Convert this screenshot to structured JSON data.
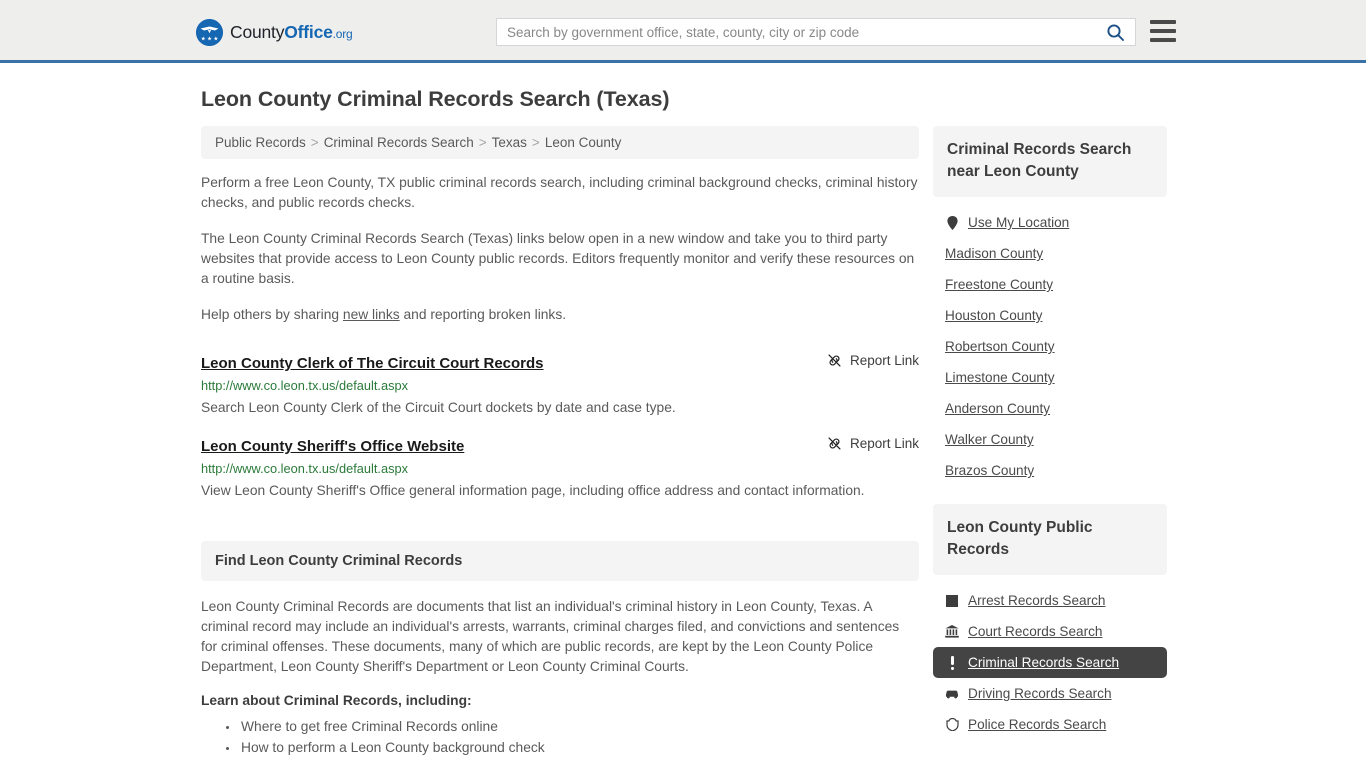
{
  "header": {
    "logo": {
      "part1": "County",
      "part2": "Office",
      "part3": ".org",
      "icon": "eagle-shield-icon"
    },
    "search": {
      "placeholder": "Search by government office, state, county, city or zip code",
      "value": "",
      "button_icon": "search-icon"
    },
    "menu_icon": "hamburger-menu-icon"
  },
  "page": {
    "title": "Leon County Criminal Records Search (Texas)"
  },
  "breadcrumb": {
    "items": [
      {
        "label": "Public Records"
      },
      {
        "label": "Criminal Records Search"
      },
      {
        "label": "Texas"
      },
      {
        "label": "Leon County"
      }
    ],
    "separator": ">"
  },
  "intro": {
    "paragraph1": "Perform a free Leon County, TX public criminal records search, including criminal background checks, criminal history checks, and public records checks.",
    "paragraph2": "The Leon County Criminal Records Search (Texas) links below open in a new window and take you to third party websites that provide access to Leon County public records. Editors frequently monitor and verify these resources on a routine basis.",
    "paragraph3_pre": "Help others by sharing ",
    "paragraph3_link": "new links",
    "paragraph3_post": " and reporting broken links."
  },
  "results": [
    {
      "title": "Leon County Clerk of The Circuit Court Records",
      "url": "http://www.co.leon.tx.us/default.aspx",
      "description": "Search Leon County Clerk of the Circuit Court dockets by date and case type.",
      "report_label": "Report Link",
      "report_icon": "broken-link-icon"
    },
    {
      "title": "Leon County Sheriff's Office Website",
      "url": "http://www.co.leon.tx.us/default.aspx",
      "description": "View Leon County Sheriff's Office general information page, including office address and contact information.",
      "report_label": "Report Link",
      "report_icon": "broken-link-icon"
    }
  ],
  "find_section": {
    "heading": "Find Leon County Criminal Records",
    "paragraph": "Leon County Criminal Records are documents that list an individual's criminal history in Leon County, Texas. A criminal record may include an individual's arrests, warrants, criminal charges filed, and convictions and sentences for criminal offenses. These documents, many of which are public records, are kept by the Leon County Police Department, Leon County Sheriff's Department or Leon County Criminal Courts.",
    "learn_heading": "Learn about Criminal Records, including:",
    "learn_items": [
      "Where to get free Criminal Records online",
      "How to perform a Leon County background check"
    ]
  },
  "sidebar": {
    "nearby_panel": {
      "heading": "Criminal Records Search near Leon County",
      "items": [
        {
          "label": "Use My Location",
          "icon": "map-pin-icon"
        },
        {
          "label": "Madison County",
          "icon": ""
        },
        {
          "label": "Freestone County",
          "icon": ""
        },
        {
          "label": "Houston County",
          "icon": ""
        },
        {
          "label": "Robertson County",
          "icon": ""
        },
        {
          "label": "Limestone County",
          "icon": ""
        },
        {
          "label": "Anderson County",
          "icon": ""
        },
        {
          "label": "Walker County",
          "icon": ""
        },
        {
          "label": "Brazos County",
          "icon": ""
        }
      ]
    },
    "public_records_panel": {
      "heading": "Leon County Public Records",
      "items": [
        {
          "label": "Arrest Records Search",
          "icon": "handcuffs-icon",
          "active": false
        },
        {
          "label": "Court Records Search",
          "icon": "courthouse-icon",
          "active": false
        },
        {
          "label": "Criminal Records Search",
          "icon": "exclamation-icon",
          "active": true
        },
        {
          "label": "Driving Records Search",
          "icon": "car-icon",
          "active": false
        },
        {
          "label": "Police Records Search",
          "icon": "police-badge-icon",
          "active": false
        }
      ]
    }
  },
  "colors": {
    "header_bg": "#eeeeed",
    "header_accent": "#3a72a8",
    "brand_blue": "#1667b2",
    "panel_bg": "#f4f4f4",
    "active_bg": "#444444",
    "url_green": "#2a7a3a",
    "text_gray": "#5a5a5a"
  }
}
